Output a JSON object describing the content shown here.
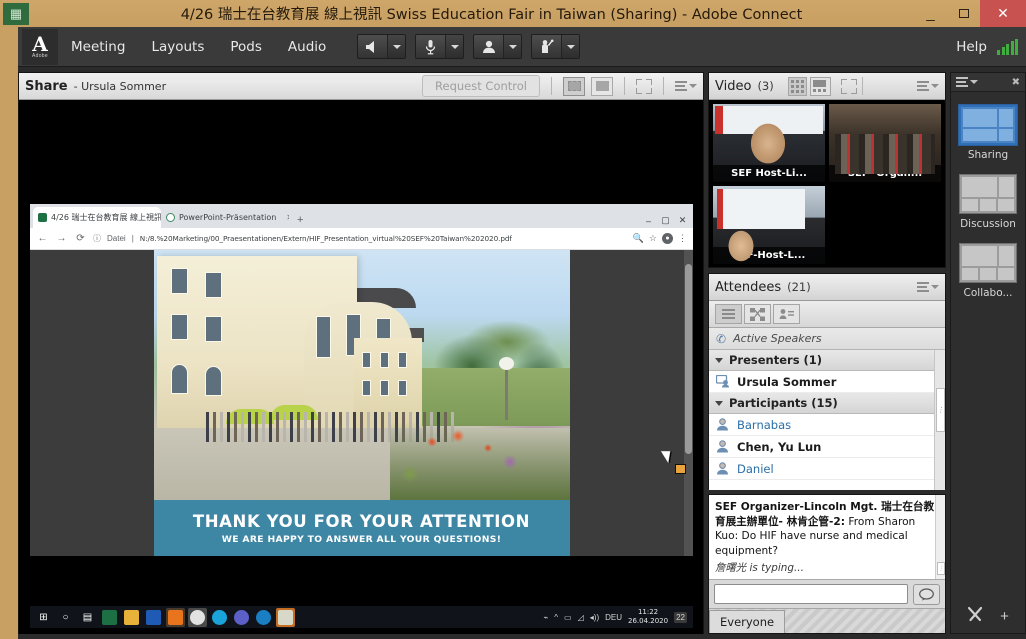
{
  "window": {
    "title": "4/26 瑞士在台教育展 線上視訊  Swiss Education Fair in Taiwan (Sharing) - Adobe Connect",
    "app_icon": "adobe-connect-icon",
    "minimize": "–",
    "maximize": "▢",
    "close": "✕"
  },
  "menubar": {
    "logo_letter": "A",
    "logo_word": "Adobe",
    "items": [
      {
        "label": "Meeting"
      },
      {
        "label": "Layouts"
      },
      {
        "label": "Pods"
      },
      {
        "label": "Audio"
      }
    ],
    "controls": [
      {
        "name": "speaker-button",
        "icon": "speaker-icon"
      },
      {
        "name": "microphone-button",
        "icon": "microphone-icon"
      },
      {
        "name": "webcam-button",
        "icon": "webcam-icon"
      },
      {
        "name": "raise-hand-button",
        "icon": "raise-hand-icon"
      }
    ],
    "help_label": "Help",
    "connection_icon": "signal-bars-icon",
    "connection_color": "#3fae3f"
  },
  "share_pod": {
    "title": "Share",
    "subtitle": "- Ursula Sommer",
    "request_control_label": "Request Control",
    "fit_buttons": [
      "fit-in-pod-icon",
      "fit-actual-size-icon"
    ],
    "fullscreen_label": "full-screen-icon",
    "menu_label": "pod-options-icon"
  },
  "shared_screen": {
    "browser": {
      "tabs": [
        {
          "label": "4/26 瑞士在台教育展 線上視訊 S",
          "favicon": "excel-icon",
          "active": true
        },
        {
          "label": "PowerPoint-Präsentation",
          "favicon": "globe-icon",
          "active": false
        }
      ],
      "new_tab": "+",
      "window_controls": [
        "–",
        "▢",
        "✕"
      ],
      "back": "←",
      "forward": "→",
      "reload": "⟳",
      "info_icon": "ⓘ",
      "scheme_label": "Datei",
      "url": "N:/8.%20Marketing/00_Praesentationen/Extern/HIF_Presentation_virtual%20SEF%20Taiwan%202020.pdf",
      "zoom_icon": "🔍",
      "star_icon": "☆",
      "profile_icon": "profile-avatar",
      "menu_icon": "⋮"
    },
    "slide": {
      "headline": "THANK YOU FOR YOUR ATTENTION",
      "subline": "WE ARE HAPPY TO ANSWER ALL YOUR QUESTIONS!",
      "band_color": "#3e87a4",
      "photo_alt": "Swiss school campus building with people on terrace"
    },
    "taskbar": {
      "start": "⊞",
      "search": "○",
      "taskview": "▤",
      "apps": [
        {
          "name": "excel-taskbar-icon",
          "color": "#1d7044"
        },
        {
          "name": "explorer-taskbar-icon",
          "color": "#e8b23a"
        },
        {
          "name": "word-taskbar-icon",
          "color": "#1f5bb5"
        },
        {
          "name": "outlook-taskbar-icon",
          "color": "#e8741e"
        },
        {
          "name": "chrome-taskbar-icon",
          "color": "#d9d9d9"
        },
        {
          "name": "skype-taskbar-icon",
          "color": "#19a3d8"
        },
        {
          "name": "teams-taskbar-icon",
          "color": "#5b5fc7"
        },
        {
          "name": "edge-taskbar-icon",
          "color": "#1a7ec2"
        },
        {
          "name": "excel2-taskbar-icon",
          "color": "#c56d22"
        }
      ],
      "tray": [
        "share-tray-icon",
        "chevron-up-icon",
        "monitor-tray-icon",
        "network-tray-icon",
        "volume-tray-icon"
      ],
      "language": "DEU",
      "time": "11:22",
      "date": "26.04.2020",
      "notification_count": "22"
    }
  },
  "video_pod": {
    "title": "Video",
    "count": "(3)",
    "grid_button": "grid-view-icon",
    "large_button": "filmstrip-view-icon",
    "fullscreen_button": "full-screen-icon",
    "menu_button": "pod-options-icon",
    "thumbnails": [
      {
        "label": "SEF Host-Li..."
      },
      {
        "label": "SEF -Organ..."
      },
      {
        "label": "SEF-Host-L..."
      }
    ]
  },
  "attendees_pod": {
    "title": "Attendees",
    "count": "(21)",
    "menu_button": "pod-options-icon",
    "view_buttons": [
      "list-view-icon",
      "breakout-view-icon",
      "status-view-icon"
    ],
    "active_speakers_label": "Active Speakers",
    "active_speakers_icon": "phone-speaker-icon",
    "groups": [
      {
        "label": "Presenters (1)",
        "members": [
          {
            "name": "Ursula Sommer",
            "icon": "presenter-icon",
            "highlight": false
          }
        ]
      },
      {
        "label": "Participants (15)",
        "members": [
          {
            "name": "Barnabas",
            "icon": "participant-icon",
            "highlight": true
          },
          {
            "name": "Chen, Yu Lun",
            "icon": "participant-icon",
            "highlight": false
          },
          {
            "name": "Daniel",
            "icon": "participant-icon",
            "highlight": true
          }
        ]
      }
    ]
  },
  "chat_pod": {
    "message_sender": "SEF Organizer-Lincoln Mgt. 瑞士在台教育展主辦單位- 林肯企管-2:",
    "message_body": " From Sharon Kuo: Do HIF have nurse and medical equipment?",
    "typing_notice": "詹曙光 is typing...",
    "input_value": "",
    "input_placeholder": "",
    "send_icon": "chat-bubble-icon",
    "tab_label": "Everyone"
  },
  "layouts_panel": {
    "menu_icon": "pod-options-icon",
    "close_icon": "✖",
    "items": [
      {
        "label": "Sharing",
        "selected": true
      },
      {
        "label": "Discussion",
        "selected": false
      },
      {
        "label": "Collabo...",
        "selected": false
      }
    ],
    "tools_icon": "tools-icon",
    "add_icon": "+"
  }
}
